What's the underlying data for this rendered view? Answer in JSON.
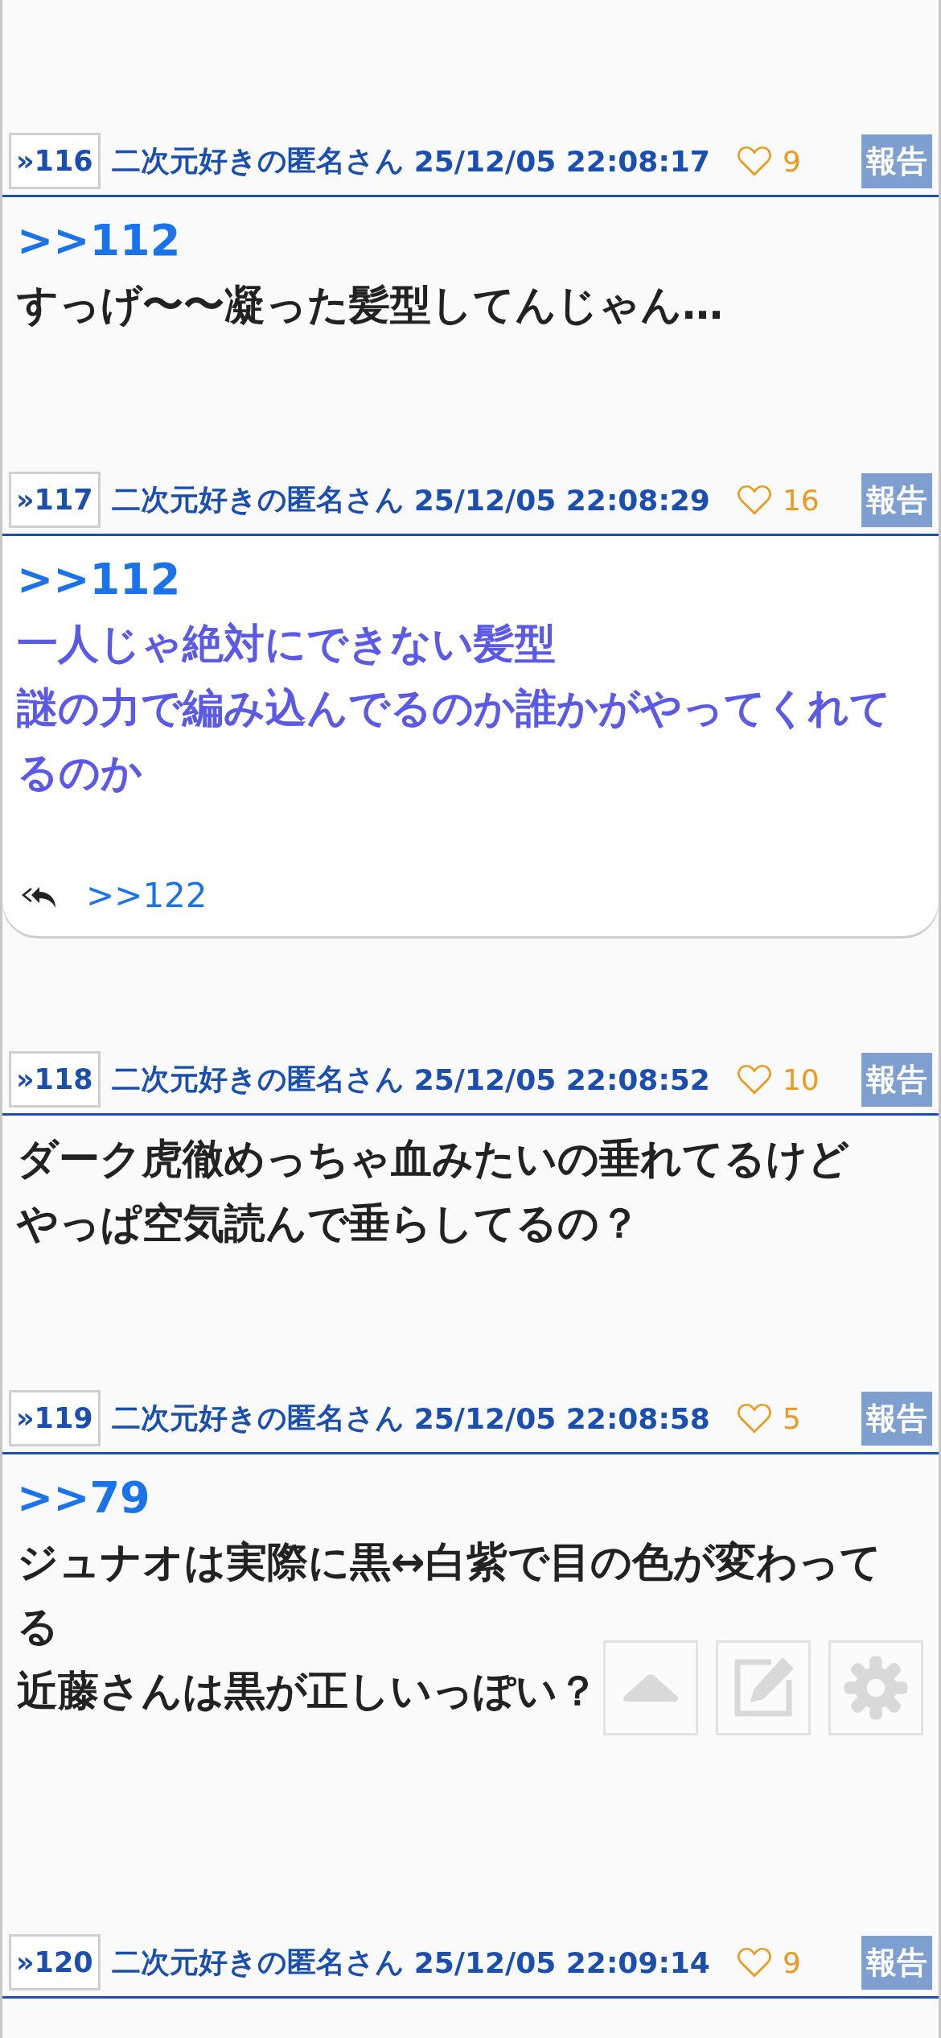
{
  "posts": [
    {
      "number": "»116",
      "name": "二次元好きの匿名さん",
      "date": "25/12/05 22:08:17",
      "likes": "9",
      "report": "報告",
      "highlighted": false,
      "anchor": ">>112",
      "lines": [
        "すっげ〜〜凝った髪型してんじゃん…"
      ]
    },
    {
      "number": "»117",
      "name": "二次元好きの匿名さん",
      "date": "25/12/05 22:08:29",
      "likes": "16",
      "report": "報告",
      "highlighted": true,
      "anchor": ">>112",
      "lines": [
        "一人じゃ絶対にできない髪型",
        "謎の力で編み込んでるのか誰かがやってくれてるのか"
      ],
      "replies": [
        ">>122"
      ]
    },
    {
      "number": "»118",
      "name": "二次元好きの匿名さん",
      "date": "25/12/05 22:08:52",
      "likes": "10",
      "report": "報告",
      "highlighted": false,
      "lines": [
        "ダーク虎徹めっちゃ血みたいの垂れてるけど",
        "やっぱ空気読んで垂らしてるの？"
      ]
    },
    {
      "number": "»119",
      "name": "二次元好きの匿名さん",
      "date": "25/12/05 22:08:58",
      "likes": "5",
      "report": "報告",
      "highlighted": false,
      "anchor": ">>79",
      "lines": [
        "ジュナオは実際に黒↔白紫で目の色が変わってる",
        "近藤さんは黒が正しいっぽい？"
      ]
    },
    {
      "number": "»120",
      "name": "二次元好きの匿名さん",
      "date": "25/12/05 22:09:14",
      "likes": "9",
      "report": "報告",
      "highlighted": false
    }
  ]
}
